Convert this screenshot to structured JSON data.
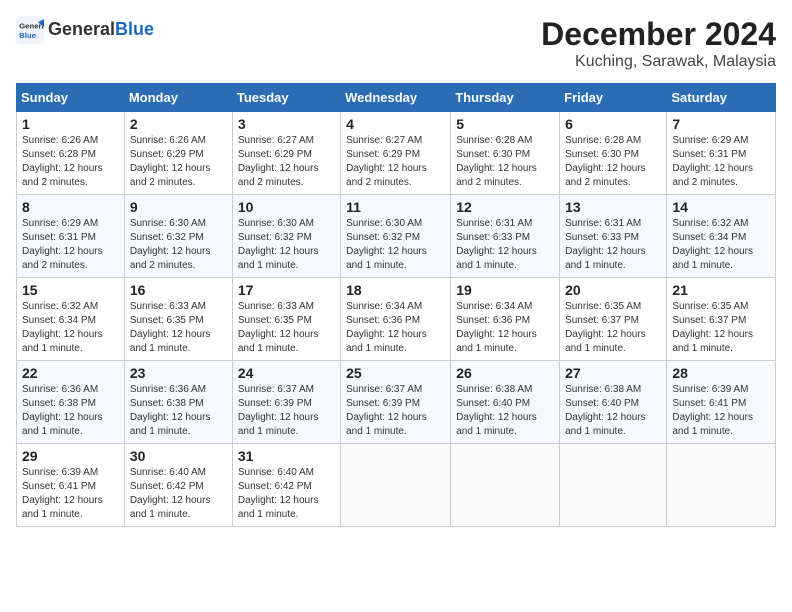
{
  "header": {
    "logo_line1": "General",
    "logo_line2": "Blue",
    "month": "December 2024",
    "location": "Kuching, Sarawak, Malaysia"
  },
  "weekdays": [
    "Sunday",
    "Monday",
    "Tuesday",
    "Wednesday",
    "Thursday",
    "Friday",
    "Saturday"
  ],
  "weeks": [
    [
      {
        "day": "1",
        "sunrise": "Sunrise: 6:26 AM",
        "sunset": "Sunset: 6:28 PM",
        "daylight": "Daylight: 12 hours and 2 minutes."
      },
      {
        "day": "2",
        "sunrise": "Sunrise: 6:26 AM",
        "sunset": "Sunset: 6:29 PM",
        "daylight": "Daylight: 12 hours and 2 minutes."
      },
      {
        "day": "3",
        "sunrise": "Sunrise: 6:27 AM",
        "sunset": "Sunset: 6:29 PM",
        "daylight": "Daylight: 12 hours and 2 minutes."
      },
      {
        "day": "4",
        "sunrise": "Sunrise: 6:27 AM",
        "sunset": "Sunset: 6:29 PM",
        "daylight": "Daylight: 12 hours and 2 minutes."
      },
      {
        "day": "5",
        "sunrise": "Sunrise: 6:28 AM",
        "sunset": "Sunset: 6:30 PM",
        "daylight": "Daylight: 12 hours and 2 minutes."
      },
      {
        "day": "6",
        "sunrise": "Sunrise: 6:28 AM",
        "sunset": "Sunset: 6:30 PM",
        "daylight": "Daylight: 12 hours and 2 minutes."
      },
      {
        "day": "7",
        "sunrise": "Sunrise: 6:29 AM",
        "sunset": "Sunset: 6:31 PM",
        "daylight": "Daylight: 12 hours and 2 minutes."
      }
    ],
    [
      {
        "day": "8",
        "sunrise": "Sunrise: 6:29 AM",
        "sunset": "Sunset: 6:31 PM",
        "daylight": "Daylight: 12 hours and 2 minutes."
      },
      {
        "day": "9",
        "sunrise": "Sunrise: 6:30 AM",
        "sunset": "Sunset: 6:32 PM",
        "daylight": "Daylight: 12 hours and 2 minutes."
      },
      {
        "day": "10",
        "sunrise": "Sunrise: 6:30 AM",
        "sunset": "Sunset: 6:32 PM",
        "daylight": "Daylight: 12 hours and 1 minute."
      },
      {
        "day": "11",
        "sunrise": "Sunrise: 6:30 AM",
        "sunset": "Sunset: 6:32 PM",
        "daylight": "Daylight: 12 hours and 1 minute."
      },
      {
        "day": "12",
        "sunrise": "Sunrise: 6:31 AM",
        "sunset": "Sunset: 6:33 PM",
        "daylight": "Daylight: 12 hours and 1 minute."
      },
      {
        "day": "13",
        "sunrise": "Sunrise: 6:31 AM",
        "sunset": "Sunset: 6:33 PM",
        "daylight": "Daylight: 12 hours and 1 minute."
      },
      {
        "day": "14",
        "sunrise": "Sunrise: 6:32 AM",
        "sunset": "Sunset: 6:34 PM",
        "daylight": "Daylight: 12 hours and 1 minute."
      }
    ],
    [
      {
        "day": "15",
        "sunrise": "Sunrise: 6:32 AM",
        "sunset": "Sunset: 6:34 PM",
        "daylight": "Daylight: 12 hours and 1 minute."
      },
      {
        "day": "16",
        "sunrise": "Sunrise: 6:33 AM",
        "sunset": "Sunset: 6:35 PM",
        "daylight": "Daylight: 12 hours and 1 minute."
      },
      {
        "day": "17",
        "sunrise": "Sunrise: 6:33 AM",
        "sunset": "Sunset: 6:35 PM",
        "daylight": "Daylight: 12 hours and 1 minute."
      },
      {
        "day": "18",
        "sunrise": "Sunrise: 6:34 AM",
        "sunset": "Sunset: 6:36 PM",
        "daylight": "Daylight: 12 hours and 1 minute."
      },
      {
        "day": "19",
        "sunrise": "Sunrise: 6:34 AM",
        "sunset": "Sunset: 6:36 PM",
        "daylight": "Daylight: 12 hours and 1 minute."
      },
      {
        "day": "20",
        "sunrise": "Sunrise: 6:35 AM",
        "sunset": "Sunset: 6:37 PM",
        "daylight": "Daylight: 12 hours and 1 minute."
      },
      {
        "day": "21",
        "sunrise": "Sunrise: 6:35 AM",
        "sunset": "Sunset: 6:37 PM",
        "daylight": "Daylight: 12 hours and 1 minute."
      }
    ],
    [
      {
        "day": "22",
        "sunrise": "Sunrise: 6:36 AM",
        "sunset": "Sunset: 6:38 PM",
        "daylight": "Daylight: 12 hours and 1 minute."
      },
      {
        "day": "23",
        "sunrise": "Sunrise: 6:36 AM",
        "sunset": "Sunset: 6:38 PM",
        "daylight": "Daylight: 12 hours and 1 minute."
      },
      {
        "day": "24",
        "sunrise": "Sunrise: 6:37 AM",
        "sunset": "Sunset: 6:39 PM",
        "daylight": "Daylight: 12 hours and 1 minute."
      },
      {
        "day": "25",
        "sunrise": "Sunrise: 6:37 AM",
        "sunset": "Sunset: 6:39 PM",
        "daylight": "Daylight: 12 hours and 1 minute."
      },
      {
        "day": "26",
        "sunrise": "Sunrise: 6:38 AM",
        "sunset": "Sunset: 6:40 PM",
        "daylight": "Daylight: 12 hours and 1 minute."
      },
      {
        "day": "27",
        "sunrise": "Sunrise: 6:38 AM",
        "sunset": "Sunset: 6:40 PM",
        "daylight": "Daylight: 12 hours and 1 minute."
      },
      {
        "day": "28",
        "sunrise": "Sunrise: 6:39 AM",
        "sunset": "Sunset: 6:41 PM",
        "daylight": "Daylight: 12 hours and 1 minute."
      }
    ],
    [
      {
        "day": "29",
        "sunrise": "Sunrise: 6:39 AM",
        "sunset": "Sunset: 6:41 PM",
        "daylight": "Daylight: 12 hours and 1 minute."
      },
      {
        "day": "30",
        "sunrise": "Sunrise: 6:40 AM",
        "sunset": "Sunset: 6:42 PM",
        "daylight": "Daylight: 12 hours and 1 minute."
      },
      {
        "day": "31",
        "sunrise": "Sunrise: 6:40 AM",
        "sunset": "Sunset: 6:42 PM",
        "daylight": "Daylight: 12 hours and 1 minute."
      },
      null,
      null,
      null,
      null
    ]
  ]
}
